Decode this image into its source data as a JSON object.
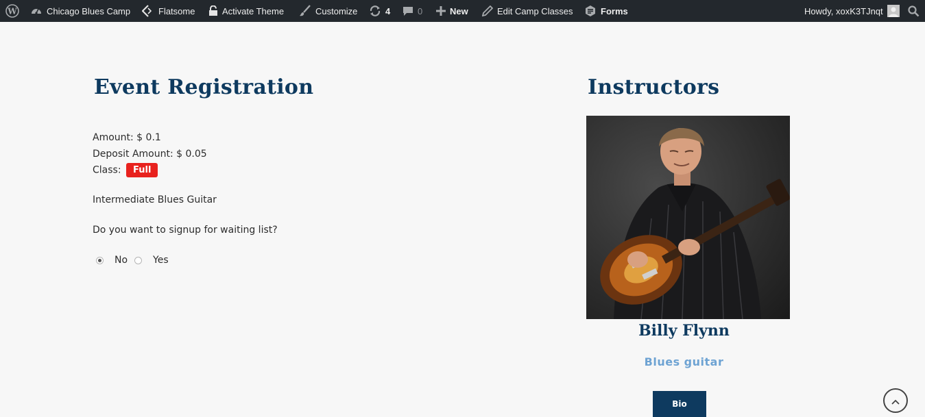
{
  "adminbar": {
    "site_name": "Chicago Blues Camp",
    "theme": "Flatsome",
    "activate_theme": "Activate Theme",
    "customize": "Customize",
    "updates_count": "4",
    "comments_count": "0",
    "new_label": "New",
    "edit_label": "Edit Camp Classes",
    "forms_label": "Forms",
    "greeting": "Howdy, xoxK3TJnqt"
  },
  "registration": {
    "title": "Event Registration",
    "amount": "Amount: $ 0.1",
    "deposit": "Deposit Amount: $ 0.05",
    "class_label": "Class:",
    "class_status": "Full",
    "class_name": "Intermediate Blues Guitar",
    "waitlist_question": "Do you want to signup for waiting list?",
    "options": [
      "No",
      "Yes"
    ],
    "selected": "No"
  },
  "instructors": {
    "title": "Instructors",
    "name": "Billy Flynn",
    "instrument": "Blues guitar",
    "bio_button": "Bio"
  },
  "colors": {
    "adminbar_bg": "#23282d",
    "heading": "#0e3a5f",
    "badge_full": "#e8221e",
    "accent_light": "#6ea3d3",
    "page_bg": "#f7f7f7"
  },
  "icons": [
    "wordpress-icon",
    "dashboard-icon",
    "flatsome-icon",
    "lock-icon",
    "brush-icon",
    "updates-icon",
    "comment-icon",
    "plus-icon",
    "pencil-icon",
    "forms-icon",
    "avatar",
    "search-icon",
    "chevron-up-icon"
  ]
}
